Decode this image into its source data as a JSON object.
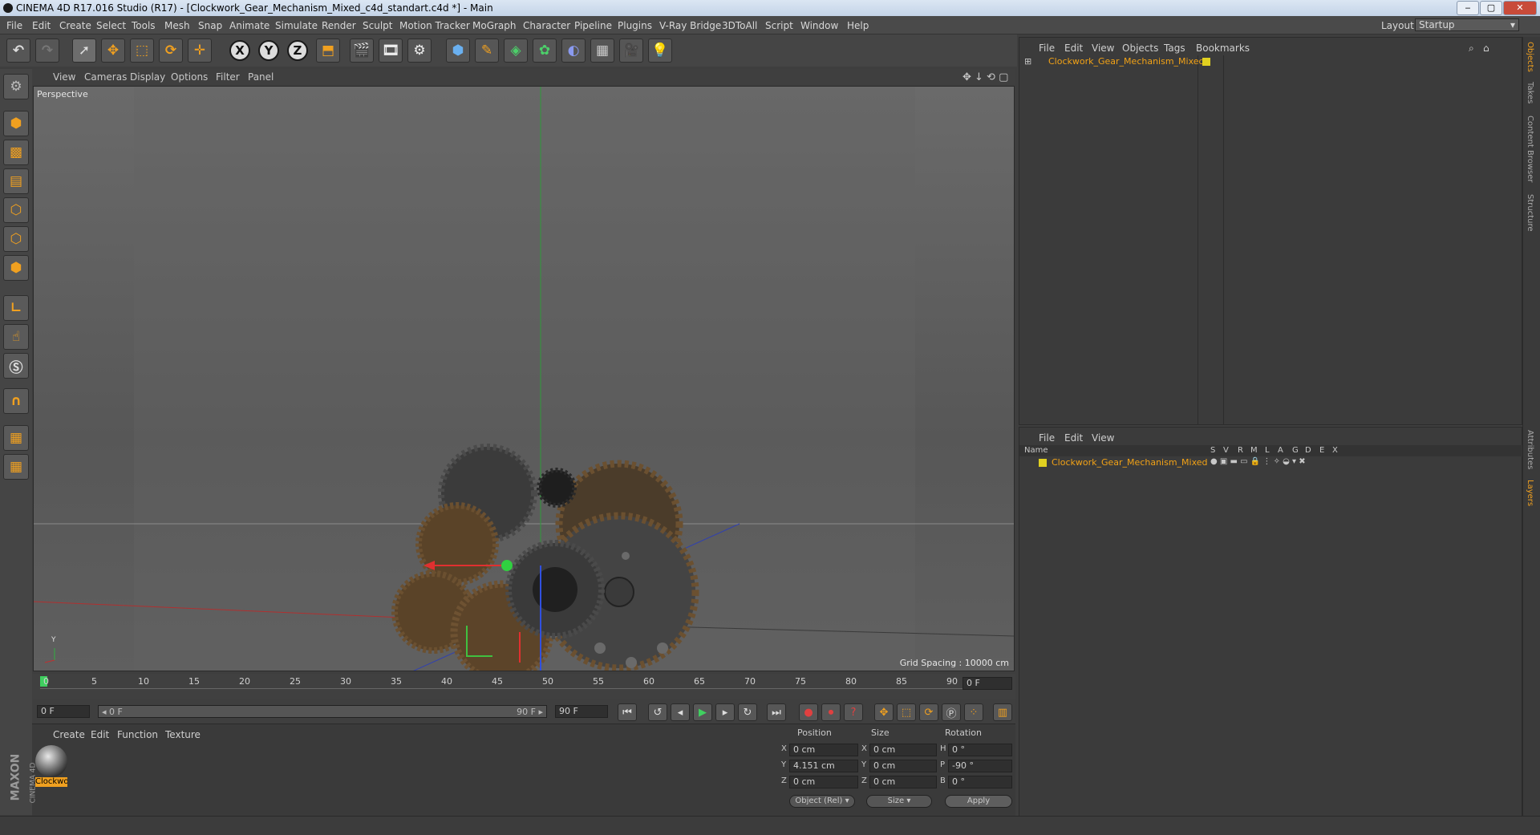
{
  "window": {
    "title": "CINEMA 4D R17.016 Studio (R17) - [Clockwork_Gear_Mechanism_Mixed_c4d_standart.c4d *] - Main",
    "min": "‒",
    "max": "▢",
    "close": "✕"
  },
  "menu": [
    "File",
    "Edit",
    "Create",
    "Select",
    "Tools",
    "Mesh",
    "Snap",
    "Animate",
    "Simulate",
    "Render",
    "Sculpt",
    "Motion Tracker",
    "MoGraph",
    "Character",
    "Pipeline",
    "Plugins",
    "V-Ray Bridge",
    "3DToAll",
    "Script",
    "Window",
    "Help"
  ],
  "layout": {
    "label": "Layout:",
    "value": "Startup"
  },
  "toolbar": {
    "axis_x": "X",
    "axis_y": "Y",
    "axis_z": "Z"
  },
  "viewport": {
    "menu": [
      "View",
      "Cameras",
      "Display",
      "Options",
      "Filter",
      "Panel"
    ],
    "label": "Perspective",
    "grid_spacing": "Grid Spacing : 10000 cm",
    "axis_y": "Y"
  },
  "timeline": {
    "ticks": [
      "0",
      "5",
      "10",
      "15",
      "20",
      "25",
      "30",
      "35",
      "40",
      "45",
      "50",
      "55",
      "60",
      "65",
      "70",
      "75",
      "80",
      "85",
      "90"
    ],
    "current_frame": "0 F"
  },
  "transport": {
    "start": "0 F",
    "range_start": "◂ 0 F",
    "range_end": "90 F ▸",
    "end": "90 F"
  },
  "materials": {
    "menu": [
      "Create",
      "Edit",
      "Function",
      "Texture"
    ],
    "items": [
      {
        "name": "Clockwo"
      }
    ]
  },
  "attributes": {
    "headers": [
      "Position",
      "Size",
      "Rotation"
    ],
    "rows": [
      {
        "axis": "X",
        "pos": "0 cm",
        "size_axis": "X",
        "size": "0 cm",
        "rot_axis": "H",
        "rot": "0 °"
      },
      {
        "axis": "Y",
        "pos": "4.151 cm",
        "size_axis": "Y",
        "size": "0 cm",
        "rot_axis": "P",
        "rot": "-90 °"
      },
      {
        "axis": "Z",
        "pos": "0 cm",
        "size_axis": "Z",
        "size": "0 cm",
        "rot_axis": "B",
        "rot": "0 °"
      }
    ],
    "coord_mode": "Object (Rel)",
    "size_mode": "Size",
    "apply": "Apply"
  },
  "objects": {
    "menu": [
      "File",
      "Edit",
      "View",
      "Objects",
      "Tags",
      "Bookmarks"
    ],
    "items": [
      {
        "name": "Clockwork_Gear_Mechanism_Mixed"
      }
    ]
  },
  "layers": {
    "menu": [
      "File",
      "Edit",
      "View"
    ],
    "columns": [
      "Name",
      "S",
      "V",
      "R",
      "M",
      "L",
      "A",
      "G",
      "D",
      "E",
      "X"
    ],
    "items": [
      {
        "name": "Clockwork_Gear_Mechanism_Mixed"
      }
    ]
  },
  "side_tabs": [
    "Objects",
    "Takes",
    "Content Browser",
    "Structure",
    "Attributes",
    "Layers"
  ],
  "brand": {
    "maxon": "MAXON",
    "product": "CINEMA 4D"
  },
  "colors": {
    "accent": "#f0a020",
    "selected_text": "#f2a216",
    "layer_swatch": "#e0d020"
  }
}
